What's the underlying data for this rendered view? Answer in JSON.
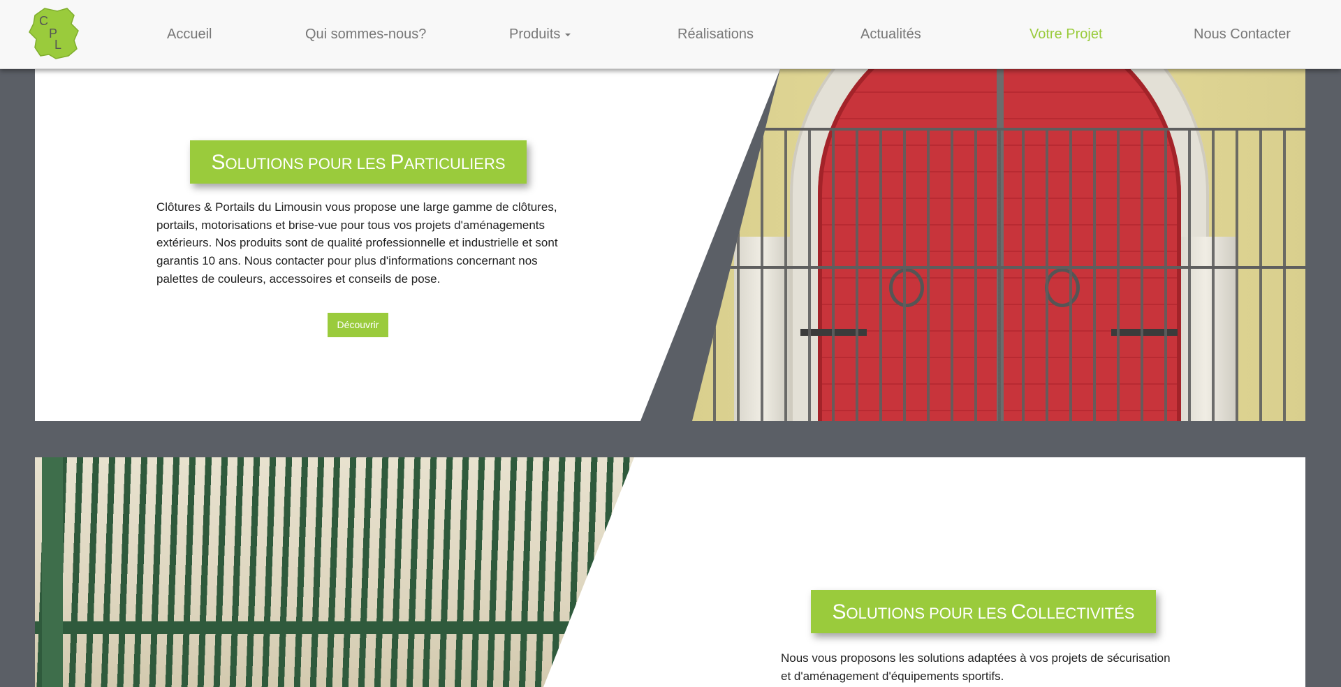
{
  "nav": {
    "logo_text": "CPL",
    "items": [
      {
        "label": "Accueil",
        "active": false
      },
      {
        "label": "Qui sommes-nous?",
        "active": false
      },
      {
        "label": "Produits",
        "active": false,
        "dropdown": true
      },
      {
        "label": "Réalisations",
        "active": false
      },
      {
        "label": "Actualités",
        "active": false
      },
      {
        "label": "Votre Projet",
        "active": true
      },
      {
        "label": "Nous Contacter",
        "active": false
      }
    ]
  },
  "particuliers": {
    "title_first": "S",
    "title_rest": "OLUTIONS POUR LES ",
    "title_first2": "P",
    "title_rest2": "ARTICULIERS",
    "description": "Clôtures & Portails du Limousin vous propose une large gamme de clôtures, portails, motorisations et brise-vue pour tous vos projets d'aménagements extérieurs. Nos produits sont de qualité professionnelle et industrielle et sont garantis 10 ans. Nous contacter pour plus d'informations concernant nos palettes de couleurs, accessoires et conseils de pose.",
    "button_label": "Découvrir"
  },
  "collectivites": {
    "title_first": "S",
    "title_rest": "OLUTIONS POUR LES ",
    "title_first2": "C",
    "title_rest2": "OLLECTIVITÉS",
    "description": "Nous vous proposons les solutions adaptées à vos projets de sécurisation et d'aménagement d'équipements sportifs."
  },
  "colors": {
    "brand_green": "#9acb3c",
    "background_gray": "#5b5f66",
    "nav_text": "#777777"
  }
}
